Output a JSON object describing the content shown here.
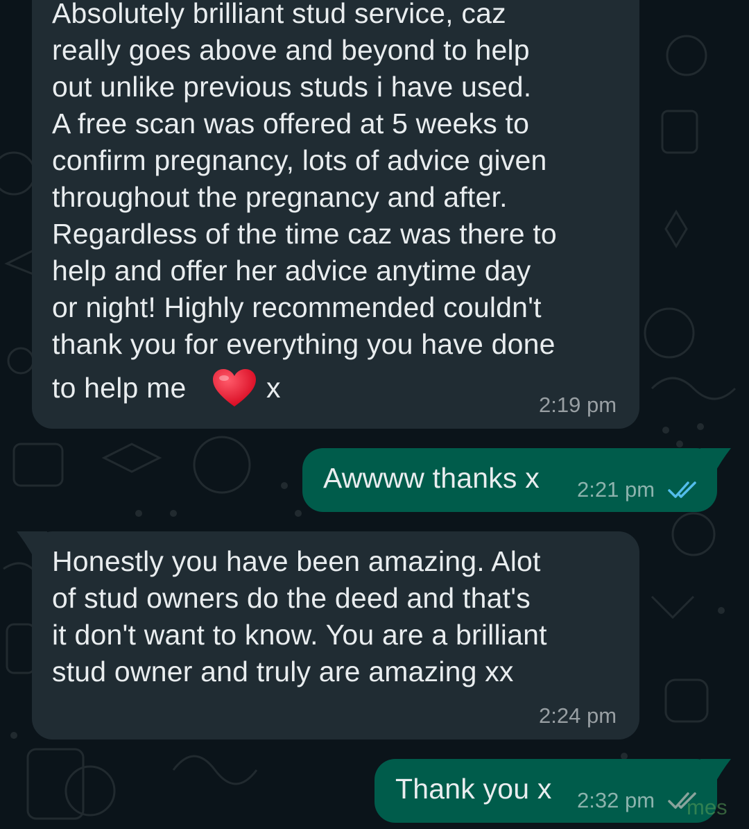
{
  "colors": {
    "background": "#0b141a",
    "incoming_bubble": "#202c33",
    "outgoing_bubble": "#005c4b",
    "text": "#e9edef",
    "read_ticks": "#53bdeb"
  },
  "messages": [
    {
      "direction": "incoming",
      "lines": [
        "Absolutely brilliant stud service, caz",
        "really goes above and beyond to help",
        "out unlike previous studs i have used.",
        "A free scan was offered at 5 weeks to",
        "confirm pregnancy, lots of advice given",
        "throughout the pregnancy and after.",
        "Regardless of the time caz was there to",
        "help and offer her advice anytime day",
        "or night! Highly recommended couldn't",
        "thank you for everything you have done"
      ],
      "last_line_before": "to help me",
      "emoji": "red-heart",
      "last_line_after": "x",
      "time": "2:19 pm"
    },
    {
      "direction": "outgoing",
      "text": "Awwww thanks x",
      "time": "2:21 pm",
      "status": "read-double-check-icon"
    },
    {
      "direction": "incoming",
      "lines": [
        "Honestly you have been amazing. Alot",
        "of stud owners do the deed and that's",
        "it don't want to know. You are a brilliant",
        "stud owner and truly are amazing xx"
      ],
      "time": "2:24 pm"
    },
    {
      "direction": "outgoing",
      "text": "Thank you x",
      "time": "2:32 pm",
      "status": "read-double-check-icon"
    }
  ],
  "watermark": "mes"
}
